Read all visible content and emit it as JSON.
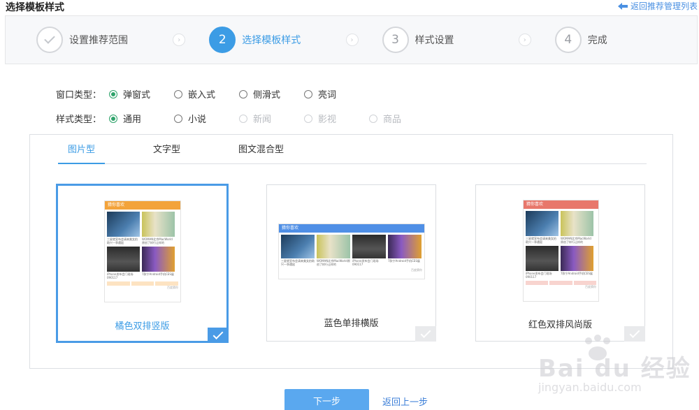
{
  "header": {
    "title": "选择模板样式",
    "back_link": "返回推荐管理列表"
  },
  "steps": [
    {
      "num": "",
      "label": "设置推荐范围",
      "state": "done"
    },
    {
      "num": "2",
      "label": "选择模板样式",
      "state": "active"
    },
    {
      "num": "3",
      "label": "样式设置",
      "state": "pending"
    },
    {
      "num": "4",
      "label": "完成",
      "state": "pending"
    }
  ],
  "window_type": {
    "label": "窗口类型：",
    "options": [
      "弹窗式",
      "嵌入式",
      "侧滑式",
      "亮词"
    ],
    "selected": "弹窗式"
  },
  "style_type": {
    "label": "样式类型：",
    "options": [
      "通用",
      "小说",
      "新闻",
      "影视",
      "商品"
    ],
    "selected": "通用",
    "disabled": [
      "新闻",
      "影视",
      "商品"
    ]
  },
  "tabs": [
    "图片型",
    "文字型",
    "图文混合型"
  ],
  "active_tab": "图片型",
  "templates": [
    {
      "title": "橘色双排竖版",
      "selected": true,
      "head": "猜你喜欢",
      "color": "#f3a33b"
    },
    {
      "title": "蓝色单排横版",
      "selected": false,
      "head": "猜你喜欢",
      "color": "#4f8fe6"
    },
    {
      "title": "红色双排风尚版",
      "selected": false,
      "head": "猜你喜欢",
      "color": "#e8776b"
    }
  ],
  "thumb_captions": [
    "三星就宣布会请来美女拍助兴一季遭殴",
    "WOMAN北京MacWorld原创了样行让样的",
    "iPhone发布会门现场090117",
    "7款宁Android手机CES展"
  ],
  "thumb_video_label": "输入给描",
  "thumb_footer": "百度猜你",
  "footer": {
    "next": "下一步",
    "prev": "返回上一步"
  },
  "watermark": {
    "main": "Bai du 经验",
    "sub": "jingyan.baidu.com"
  }
}
